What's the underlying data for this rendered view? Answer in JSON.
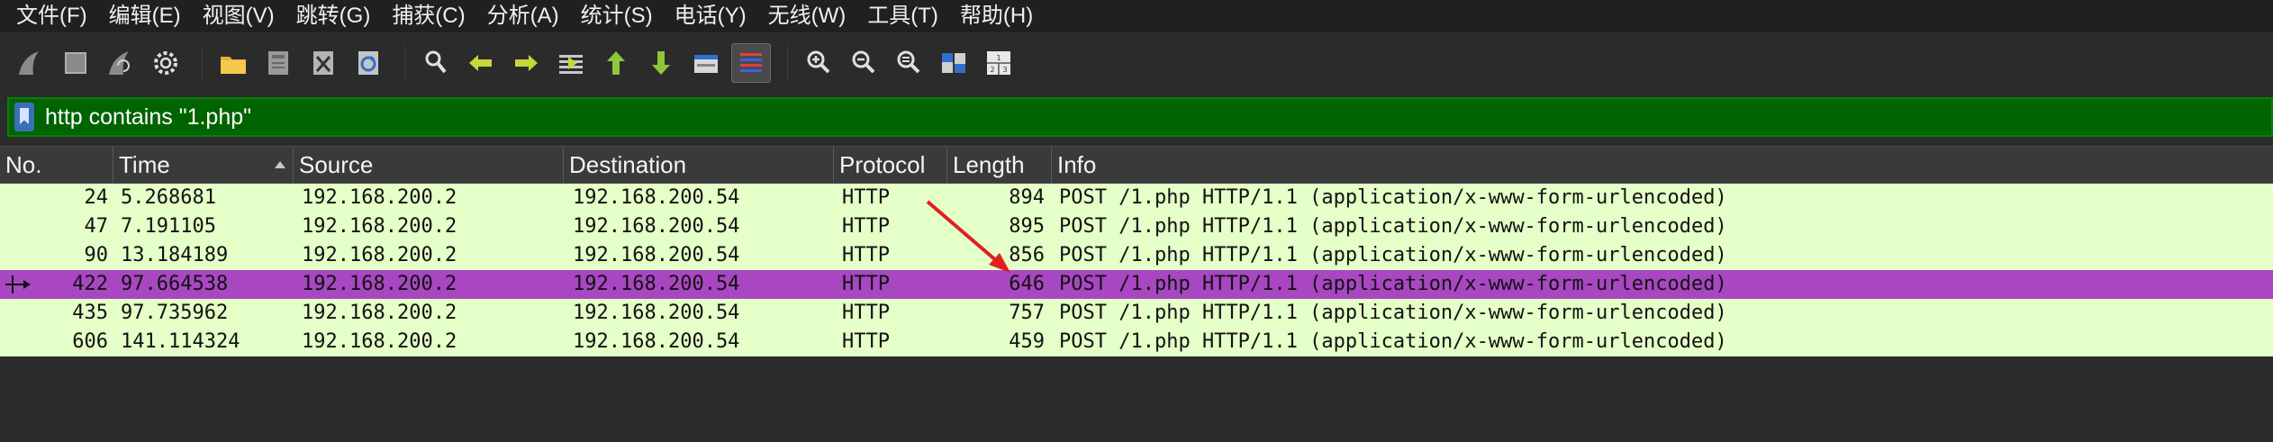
{
  "menu": [
    "文件(F)",
    "编辑(E)",
    "视图(V)",
    "跳转(G)",
    "捕获(C)",
    "分析(A)",
    "统计(S)",
    "电话(Y)",
    "无线(W)",
    "工具(T)",
    "帮助(H)"
  ],
  "toolbar": {
    "icons": [
      "shark-fin-start-icon",
      "stop-square-icon",
      "restart-fin-icon",
      "capture-options-gear-icon",
      "open-folder-icon",
      "save-file-icon",
      "close-file-icon",
      "reload-icon",
      "find-magnifier-icon",
      "go-back-arrow-icon",
      "go-forward-arrow-icon",
      "go-to-packet-icon",
      "first-packet-up-icon",
      "last-packet-down-icon",
      "autoscroll-icon",
      "colorize-lines-icon",
      "zoom-in-icon",
      "zoom-out-icon",
      "normal-size-icon",
      "resize-columns-icon",
      "layout-icon"
    ]
  },
  "filter": {
    "value": "http contains \"1.php\""
  },
  "columns": [
    "No.",
    "Time",
    "Source",
    "Destination",
    "Protocol",
    "Length",
    "Info"
  ],
  "packets": [
    {
      "no": "24",
      "time": "5.268681",
      "source": "192.168.200.2",
      "destination": "192.168.200.54",
      "protocol": "HTTP",
      "length": "894",
      "info": "POST /1.php HTTP/1.1  (application/x-www-form-urlencoded)"
    },
    {
      "no": "47",
      "time": "7.191105",
      "source": "192.168.200.2",
      "destination": "192.168.200.54",
      "protocol": "HTTP",
      "length": "895",
      "info": "POST /1.php HTTP/1.1  (application/x-www-form-urlencoded)"
    },
    {
      "no": "90",
      "time": "13.184189",
      "source": "192.168.200.2",
      "destination": "192.168.200.54",
      "protocol": "HTTP",
      "length": "856",
      "info": "POST /1.php HTTP/1.1  (application/x-www-form-urlencoded)"
    },
    {
      "no": "422",
      "time": "97.664538",
      "source": "192.168.200.2",
      "destination": "192.168.200.54",
      "protocol": "HTTP",
      "length": "646",
      "info": "POST /1.php HTTP/1.1  (application/x-www-form-urlencoded)",
      "selected": true
    },
    {
      "no": "435",
      "time": "97.735962",
      "source": "192.168.200.2",
      "destination": "192.168.200.54",
      "protocol": "HTTP",
      "length": "757",
      "info": "POST /1.php HTTP/1.1  (application/x-www-form-urlencoded)"
    },
    {
      "no": "606",
      "time": "141.114324",
      "source": "192.168.200.2",
      "destination": "192.168.200.54",
      "protocol": "HTTP",
      "length": "459",
      "info": "POST /1.php HTTP/1.1  (application/x-www-form-urlencoded)"
    }
  ],
  "colors": {
    "row_bg": "#e4ffc7",
    "selected_bg": "#a847c1",
    "filter_valid_bg": "#006400",
    "annotation_arrow": "#e02020"
  }
}
